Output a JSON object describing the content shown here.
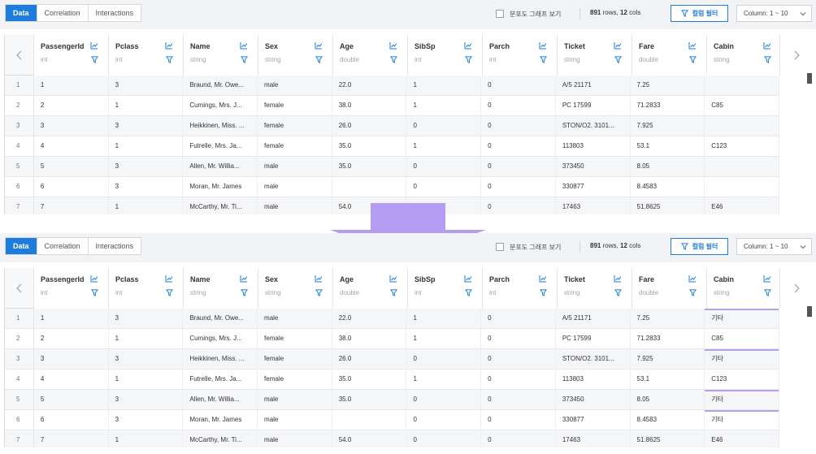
{
  "colors": {
    "accent": "#1e7cdc",
    "highlight_border": "#b8a1e8",
    "arrow": "#b39cf2"
  },
  "top": {
    "tabs": [
      {
        "label": "Data",
        "active": true
      },
      {
        "label": "Correlation",
        "active": false
      },
      {
        "label": "Interactions",
        "active": false
      }
    ],
    "toolbar": {
      "scatter_checkbox_label": "분포도 그래프 보기",
      "rows_count": "891",
      "rows_text": "rows,",
      "cols_count": "12",
      "cols_text": "cols",
      "column_filter_label": "컬럼 필터",
      "column_range_label": "Column: 1 ~ 10"
    },
    "columns": [
      {
        "name": "PassengerId",
        "type": "int"
      },
      {
        "name": "Pclass",
        "type": "int"
      },
      {
        "name": "Name",
        "type": "string"
      },
      {
        "name": "Sex",
        "type": "string"
      },
      {
        "name": "Age",
        "type": "double"
      },
      {
        "name": "SibSp",
        "type": "int"
      },
      {
        "name": "Parch",
        "type": "int"
      },
      {
        "name": "Ticket",
        "type": "string"
      },
      {
        "name": "Fare",
        "type": "double"
      },
      {
        "name": "Cabin",
        "type": "string"
      }
    ],
    "rows": [
      {
        "index": "1",
        "cells": [
          "1",
          "3",
          "Braund, Mr. Owe...",
          "male",
          "22.0",
          "1",
          "0",
          "A/5 21171",
          "7.25",
          ""
        ]
      },
      {
        "index": "2",
        "cells": [
          "2",
          "1",
          "Cumings, Mrs. J...",
          "female",
          "38.0",
          "1",
          "0",
          "PC 17599",
          "71.2833",
          "C85"
        ]
      },
      {
        "index": "3",
        "cells": [
          "3",
          "3",
          "Heikkinen, Miss. ...",
          "female",
          "26.0",
          "0",
          "0",
          "STON/O2. 3101...",
          "7.925",
          ""
        ]
      },
      {
        "index": "4",
        "cells": [
          "4",
          "1",
          "Futrelle, Mrs. Ja...",
          "female",
          "35.0",
          "1",
          "0",
          "113803",
          "53.1",
          "C123"
        ]
      },
      {
        "index": "5",
        "cells": [
          "5",
          "3",
          "Allen, Mr. Willia...",
          "male",
          "35.0",
          "0",
          "0",
          "373450",
          "8.05",
          ""
        ]
      },
      {
        "index": "6",
        "cells": [
          "6",
          "3",
          "Moran, Mr. James",
          "male",
          "",
          "0",
          "0",
          "330877",
          "8.4583",
          ""
        ]
      },
      {
        "index": "7",
        "cells": [
          "7",
          "1",
          "McCarthy, Mr. Ti...",
          "male",
          "54.0",
          "0",
          "0",
          "17463",
          "51.8625",
          "E46"
        ]
      }
    ]
  },
  "bottom": {
    "tabs": [
      {
        "label": "Data",
        "active": true
      },
      {
        "label": "Correlation",
        "active": false
      },
      {
        "label": "Interactions",
        "active": false
      }
    ],
    "toolbar": {
      "scatter_checkbox_label": "분포도 그래프 보기",
      "rows_count": "891",
      "rows_text": "rows,",
      "cols_count": "12",
      "cols_text": "cols",
      "column_filter_label": "컬럼 필터",
      "column_range_label": "Column: 1 ~ 10"
    },
    "columns": [
      {
        "name": "PassengerId",
        "type": "int"
      },
      {
        "name": "Pclass",
        "type": "int"
      },
      {
        "name": "Name",
        "type": "string"
      },
      {
        "name": "Sex",
        "type": "string"
      },
      {
        "name": "Age",
        "type": "double"
      },
      {
        "name": "SibSp",
        "type": "int"
      },
      {
        "name": "Parch",
        "type": "int"
      },
      {
        "name": "Ticket",
        "type": "string"
      },
      {
        "name": "Fare",
        "type": "double"
      },
      {
        "name": "Cabin",
        "type": "string"
      }
    ],
    "highlighted_cabin_rows": [
      "1",
      "3",
      "5",
      "6"
    ],
    "rows": [
      {
        "index": "1",
        "cells": [
          "1",
          "3",
          "Braund, Mr. Owe...",
          "male",
          "22.0",
          "1",
          "0",
          "A/5 21171",
          "7.25",
          "기타"
        ]
      },
      {
        "index": "2",
        "cells": [
          "2",
          "1",
          "Cumings, Mrs. J...",
          "female",
          "38.0",
          "1",
          "0",
          "PC 17599",
          "71.2833",
          "C85"
        ]
      },
      {
        "index": "3",
        "cells": [
          "3",
          "3",
          "Heikkinen, Miss. ...",
          "female",
          "26.0",
          "0",
          "0",
          "STON/O2. 3101...",
          "7.925",
          "기타"
        ]
      },
      {
        "index": "4",
        "cells": [
          "4",
          "1",
          "Futrelle, Mrs. Ja...",
          "female",
          "35.0",
          "1",
          "0",
          "113803",
          "53.1",
          "C123"
        ]
      },
      {
        "index": "5",
        "cells": [
          "5",
          "3",
          "Allen, Mr. Willia...",
          "male",
          "35.0",
          "0",
          "0",
          "373450",
          "8.05",
          "기타"
        ]
      },
      {
        "index": "6",
        "cells": [
          "6",
          "3",
          "Moran, Mr. James",
          "male",
          "",
          "0",
          "0",
          "330877",
          "8.4583",
          "기타"
        ]
      },
      {
        "index": "7",
        "cells": [
          "7",
          "1",
          "McCarthy, Mr. Ti...",
          "male",
          "54.0",
          "0",
          "0",
          "17463",
          "51.8625",
          "E46"
        ]
      }
    ]
  }
}
